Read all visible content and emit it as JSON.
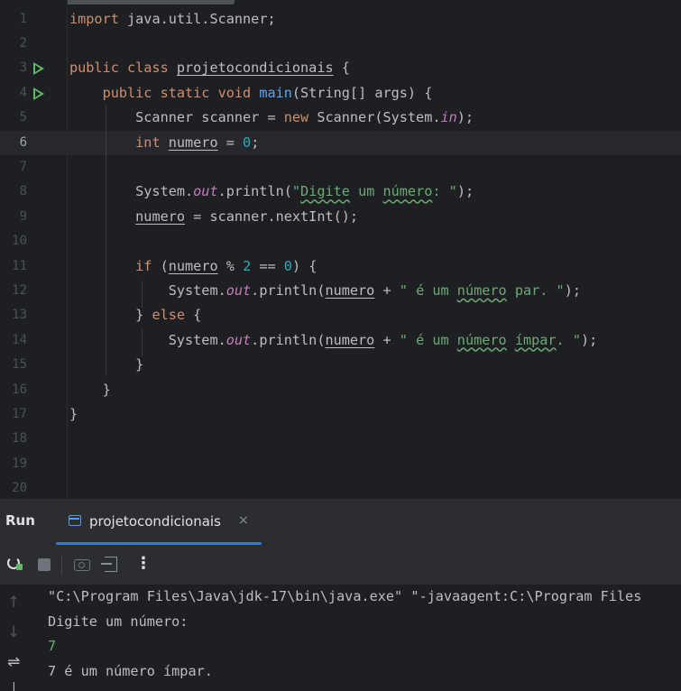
{
  "editor": {
    "current_line": 6,
    "lines": [
      {
        "num": "1",
        "tokens": [
          [
            "kw",
            "import "
          ],
          [
            "",
            "java.util.Scanner;"
          ]
        ]
      },
      {
        "num": "2",
        "tokens": []
      },
      {
        "num": "3",
        "run": true,
        "tokens": [
          [
            "kw",
            "public class "
          ],
          [
            "ul",
            "projetocondicionais"
          ],
          [
            "",
            " {"
          ]
        ]
      },
      {
        "num": "4",
        "run": true,
        "tokens": [
          [
            "",
            "    "
          ],
          [
            "kw",
            "public static void "
          ],
          [
            "fn",
            "main"
          ],
          [
            "",
            "(String[] args) {"
          ]
        ]
      },
      {
        "num": "5",
        "tokens": [
          [
            "",
            "        Scanner scanner = "
          ],
          [
            "kw",
            "new "
          ],
          [
            "",
            "Scanner(System."
          ],
          [
            "it",
            "in"
          ],
          [
            "",
            ");"
          ]
        ]
      },
      {
        "num": "6",
        "tokens": [
          [
            "",
            "        "
          ],
          [
            "kw",
            "int "
          ],
          [
            "ul",
            "numero"
          ],
          [
            "",
            " = "
          ],
          [
            "nm",
            "0"
          ],
          [
            "",
            ";"
          ]
        ]
      },
      {
        "num": "7",
        "tokens": []
      },
      {
        "num": "8",
        "tokens": [
          [
            "",
            "        System."
          ],
          [
            "it",
            "out"
          ],
          [
            "",
            ".println("
          ],
          [
            "st",
            "\""
          ],
          [
            "stw",
            "Digite"
          ],
          [
            "st",
            " um "
          ],
          [
            "stw",
            "número"
          ],
          [
            "st",
            ": \""
          ],
          [
            "",
            ");"
          ]
        ]
      },
      {
        "num": "9",
        "tokens": [
          [
            "",
            "        "
          ],
          [
            "ul",
            "numero"
          ],
          [
            "",
            " = scanner.nextInt();"
          ]
        ]
      },
      {
        "num": "10",
        "tokens": []
      },
      {
        "num": "11",
        "tokens": [
          [
            "",
            "        "
          ],
          [
            "kw",
            "if "
          ],
          [
            "",
            "("
          ],
          [
            "ul",
            "numero"
          ],
          [
            "",
            " % "
          ],
          [
            "nm",
            "2"
          ],
          [
            "",
            " == "
          ],
          [
            "nm",
            "0"
          ],
          [
            "",
            ") {"
          ]
        ]
      },
      {
        "num": "12",
        "tokens": [
          [
            "",
            "            System."
          ],
          [
            "it",
            "out"
          ],
          [
            "",
            ".println("
          ],
          [
            "ul",
            "numero"
          ],
          [
            "",
            " + "
          ],
          [
            "st",
            "\" é um "
          ],
          [
            "stw",
            "número"
          ],
          [
            "st",
            " par. \""
          ],
          [
            "",
            ");"
          ]
        ]
      },
      {
        "num": "13",
        "tokens": [
          [
            "",
            "        } "
          ],
          [
            "kw",
            "else "
          ],
          [
            "",
            "{"
          ]
        ]
      },
      {
        "num": "14",
        "tokens": [
          [
            "",
            "            System."
          ],
          [
            "it",
            "out"
          ],
          [
            "",
            ".println("
          ],
          [
            "ul",
            "numero"
          ],
          [
            "",
            " + "
          ],
          [
            "st",
            "\" é um "
          ],
          [
            "stw",
            "número"
          ],
          [
            "st",
            " "
          ],
          [
            "stw",
            "ímpar"
          ],
          [
            "st",
            ". \""
          ],
          [
            "",
            ");"
          ]
        ]
      },
      {
        "num": "15",
        "tokens": [
          [
            "",
            "        }"
          ]
        ]
      },
      {
        "num": "16",
        "tokens": [
          [
            "",
            "    }"
          ]
        ]
      },
      {
        "num": "17",
        "tokens": [
          [
            "",
            "}"
          ]
        ]
      },
      {
        "num": "18",
        "tokens": []
      },
      {
        "num": "19",
        "tokens": []
      },
      {
        "num": "20",
        "tokens": []
      }
    ]
  },
  "run_panel": {
    "title": "Run",
    "tab_label": "projetocondicionais",
    "tab_close": "×",
    "kebab": "⋮"
  },
  "console": {
    "lines": [
      {
        "text": "\"C:\\Program Files\\Java\\jdk-17\\bin\\java.exe\" \"-javaagent:C:\\Program Files",
        "kind": "output"
      },
      {
        "text": "Digite um número:",
        "kind": "output"
      },
      {
        "text": "7",
        "kind": "input"
      },
      {
        "text": "7 é um número ímpar.",
        "kind": "output"
      }
    ],
    "side_icons": {
      "up": "↑",
      "down": "↓",
      "wrap": "⇌",
      "more": "⊥"
    }
  },
  "colors": {
    "keyword": "#cf8e6d",
    "string": "#6aab73",
    "number": "#2aacb8",
    "function": "#56a8f5",
    "static_field": "#c77dbb",
    "accent": "#3574f0"
  }
}
